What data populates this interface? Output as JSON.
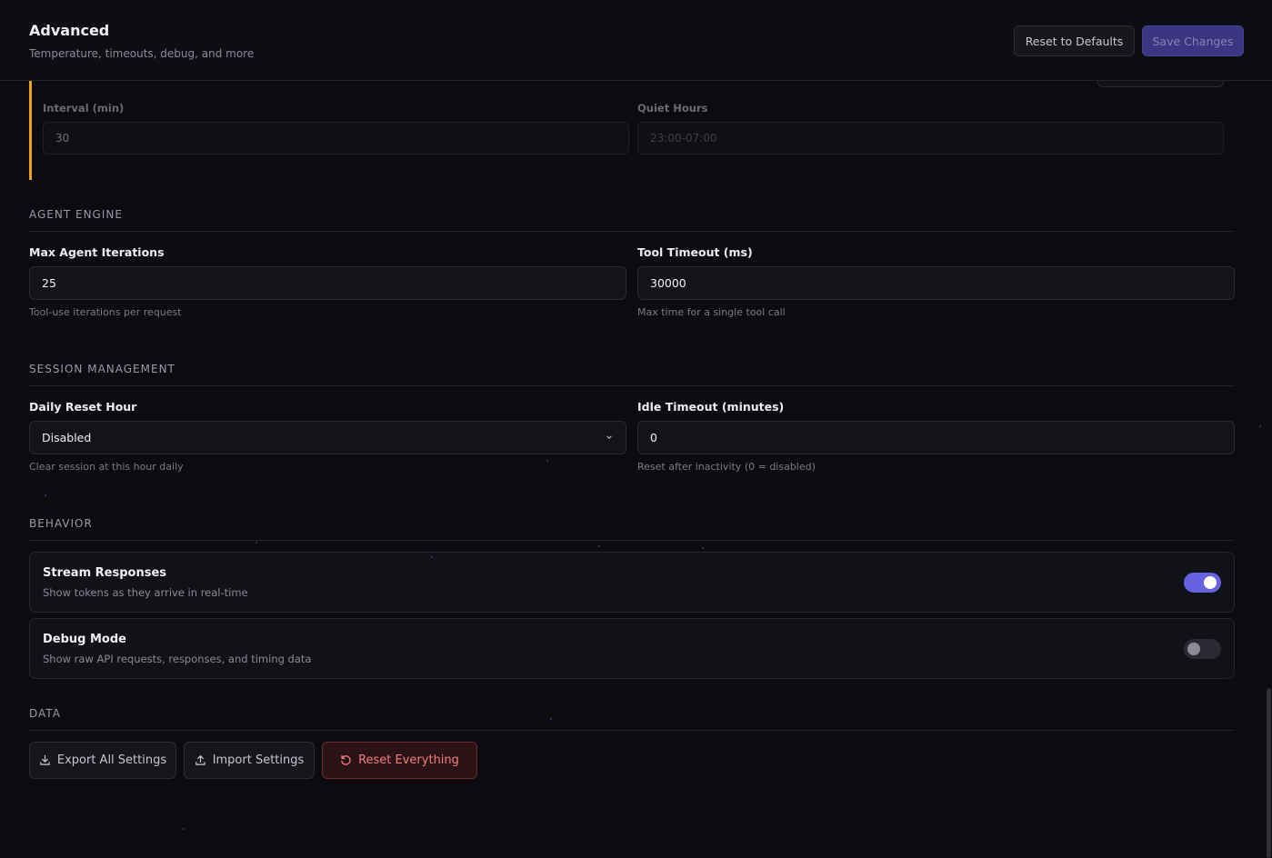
{
  "header": {
    "title": "Advanced",
    "subtitle": "Temperature, timeouts, debug, and more",
    "reset_defaults_label": "Reset to Defaults",
    "save_label": "Save Changes"
  },
  "heartbeat": {
    "interval_label": "Interval (min)",
    "interval_value": "30",
    "quiet_hours_label": "Quiet Hours",
    "quiet_hours_placeholder": "23:00-07:00",
    "accent_color": "#e8a317"
  },
  "agent_engine": {
    "heading": "AGENT ENGINE",
    "max_iterations": {
      "label": "Max Agent Iterations",
      "value": "25",
      "hint": "Tool-use iterations per request"
    },
    "tool_timeout": {
      "label": "Tool Timeout (ms)",
      "value": "30000",
      "hint": "Max time for a single tool call"
    }
  },
  "session_management": {
    "heading": "SESSION MANAGEMENT",
    "daily_reset": {
      "label": "Daily Reset Hour",
      "selected": "Disabled",
      "hint": "Clear session at this hour daily"
    },
    "idle_timeout": {
      "label": "Idle Timeout (minutes)",
      "value": "0",
      "hint": "Reset after inactivity (0 = disabled)"
    }
  },
  "behavior": {
    "heading": "BEHAVIOR",
    "stream": {
      "title": "Stream Responses",
      "desc": "Show tokens as they arrive in real-time",
      "enabled": true
    },
    "debug": {
      "title": "Debug Mode",
      "desc": "Show raw API requests, responses, and timing data",
      "enabled": false
    },
    "accent_color": "#6762e0"
  },
  "data_section": {
    "heading": "DATA",
    "export_label": "Export All Settings",
    "import_label": "Import Settings",
    "reset_everything_label": "Reset Everything",
    "danger_color": "#f0807d"
  },
  "icons": {
    "export": "download-icon",
    "import": "upload-icon",
    "reset": "rotate-ccw-icon",
    "select": "chevron-down-icon"
  }
}
